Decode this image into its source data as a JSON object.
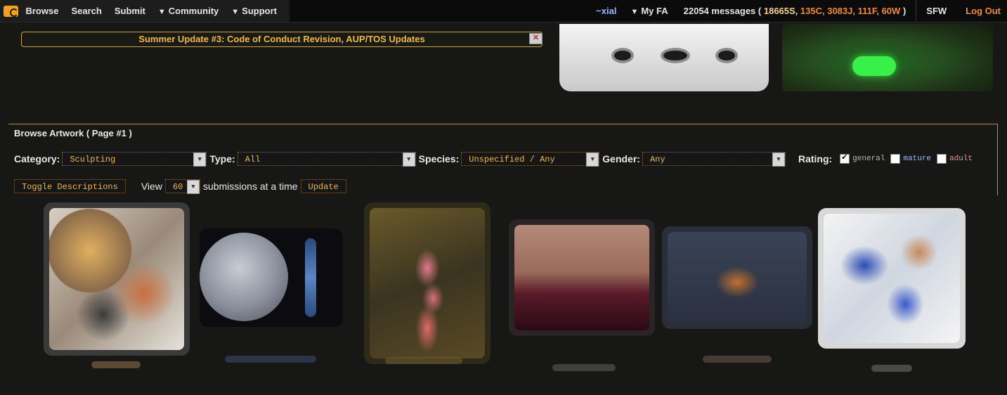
{
  "nav": {
    "left": [
      "Browse",
      "Search",
      "Submit"
    ],
    "dropdowns": [
      "Community",
      "Support"
    ],
    "user": "~xial",
    "myfa": "My FA",
    "messages_prefix": "22054 messages (",
    "msg_s": "18665S,",
    "msg_others": "135C, 3083J, 111F, 60W",
    "messages_suffix": ")",
    "sfw": "SFW",
    "logout": "Log Out"
  },
  "banner": {
    "text": "Summer Update #3: Code of Conduct Revision, AUP/TOS Updates"
  },
  "browse": {
    "title": "Browse Artwork ( Page #1 )",
    "category_label": "Category:",
    "category_value": "Sculpting",
    "type_label": "Type:",
    "type_value": "All",
    "species_label": "Species:",
    "species_value": "Unspecified / Any",
    "gender_label": "Gender:",
    "gender_value": "Any",
    "rating_label": "Rating:",
    "ratings": [
      {
        "label": "general",
        "checked": true,
        "color": "#b8b8b8"
      },
      {
        "label": "mature",
        "checked": false,
        "color": "#9fb6ff"
      },
      {
        "label": "adult",
        "checked": false,
        "color": "#e59a9a"
      }
    ],
    "toggle_label": "Toggle Descriptions",
    "view_label": "View",
    "view_value": "60",
    "per_page_label": "submissions at a time",
    "update_label": "Update"
  },
  "colors": {
    "accent": "#f0b84a",
    "orange": "#f08a3c",
    "border": "#c88d3a",
    "bg": "#171815"
  }
}
